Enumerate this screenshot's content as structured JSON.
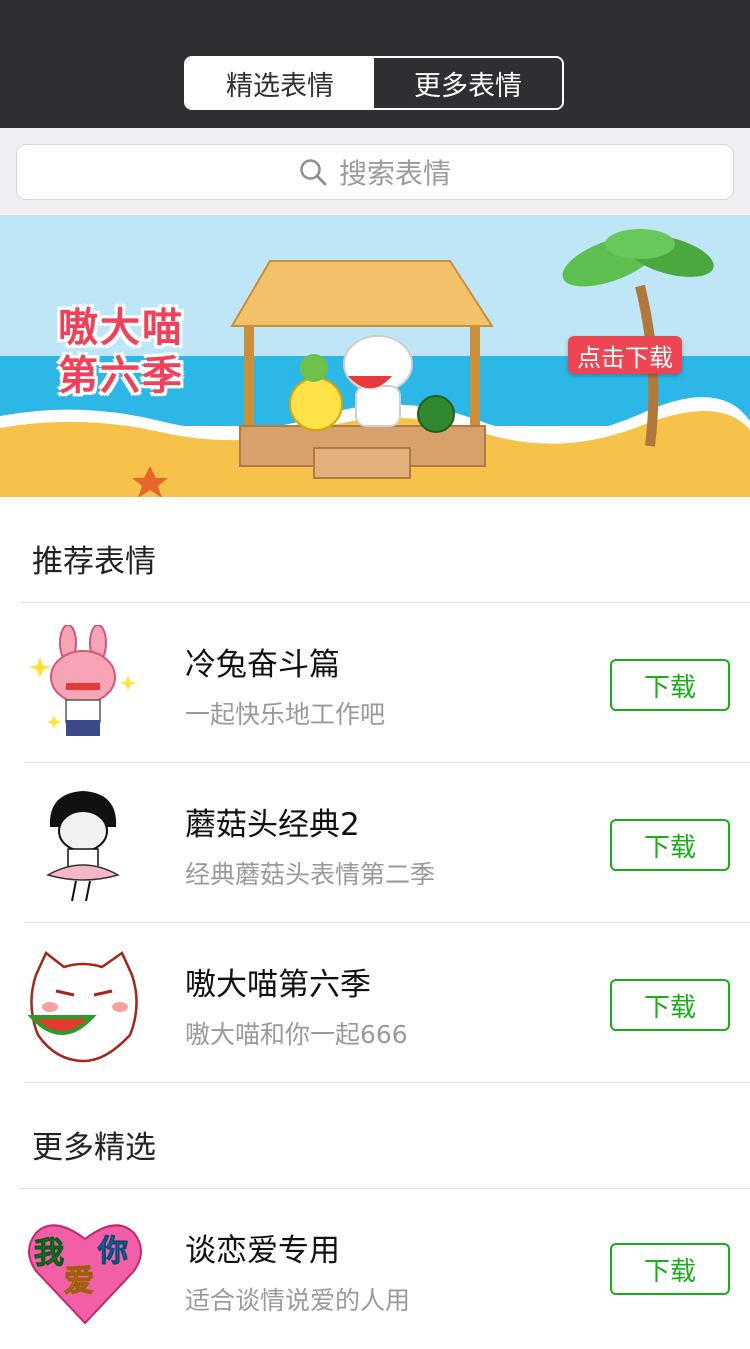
{
  "tabs": {
    "featured": "精选表情",
    "more": "更多表情"
  },
  "search": {
    "placeholder": "搜索表情"
  },
  "banner": {
    "title_line1": "嗷大喵",
    "title_line2": "第六季",
    "button": "点击下载"
  },
  "sections": {
    "recommended": "推荐表情",
    "more_featured": "更多精选"
  },
  "items": [
    {
      "name": "冷兔奋斗篇",
      "desc": "一起快乐地工作吧",
      "button": "下载",
      "icon": "bunny-sticker"
    },
    {
      "name": "蘑菇头经典2",
      "desc": "经典蘑菇头表情第二季",
      "button": "下载",
      "icon": "mushroom-head-sticker"
    },
    {
      "name": "嗷大喵第六季",
      "desc": "嗷大喵和你一起666",
      "button": "下载",
      "icon": "cat-sticker"
    },
    {
      "name": "谈恋爱专用",
      "desc": "适合谈情说爱的人用",
      "button": "下载",
      "icon": "heart-sticker",
      "sticker_text": [
        "我",
        "爱",
        "你"
      ]
    }
  ],
  "colors": {
    "accent": "#1aad19",
    "topbar": "#2e2f33",
    "banner_button": "#ec4654",
    "banner_title": "#f0405a"
  }
}
